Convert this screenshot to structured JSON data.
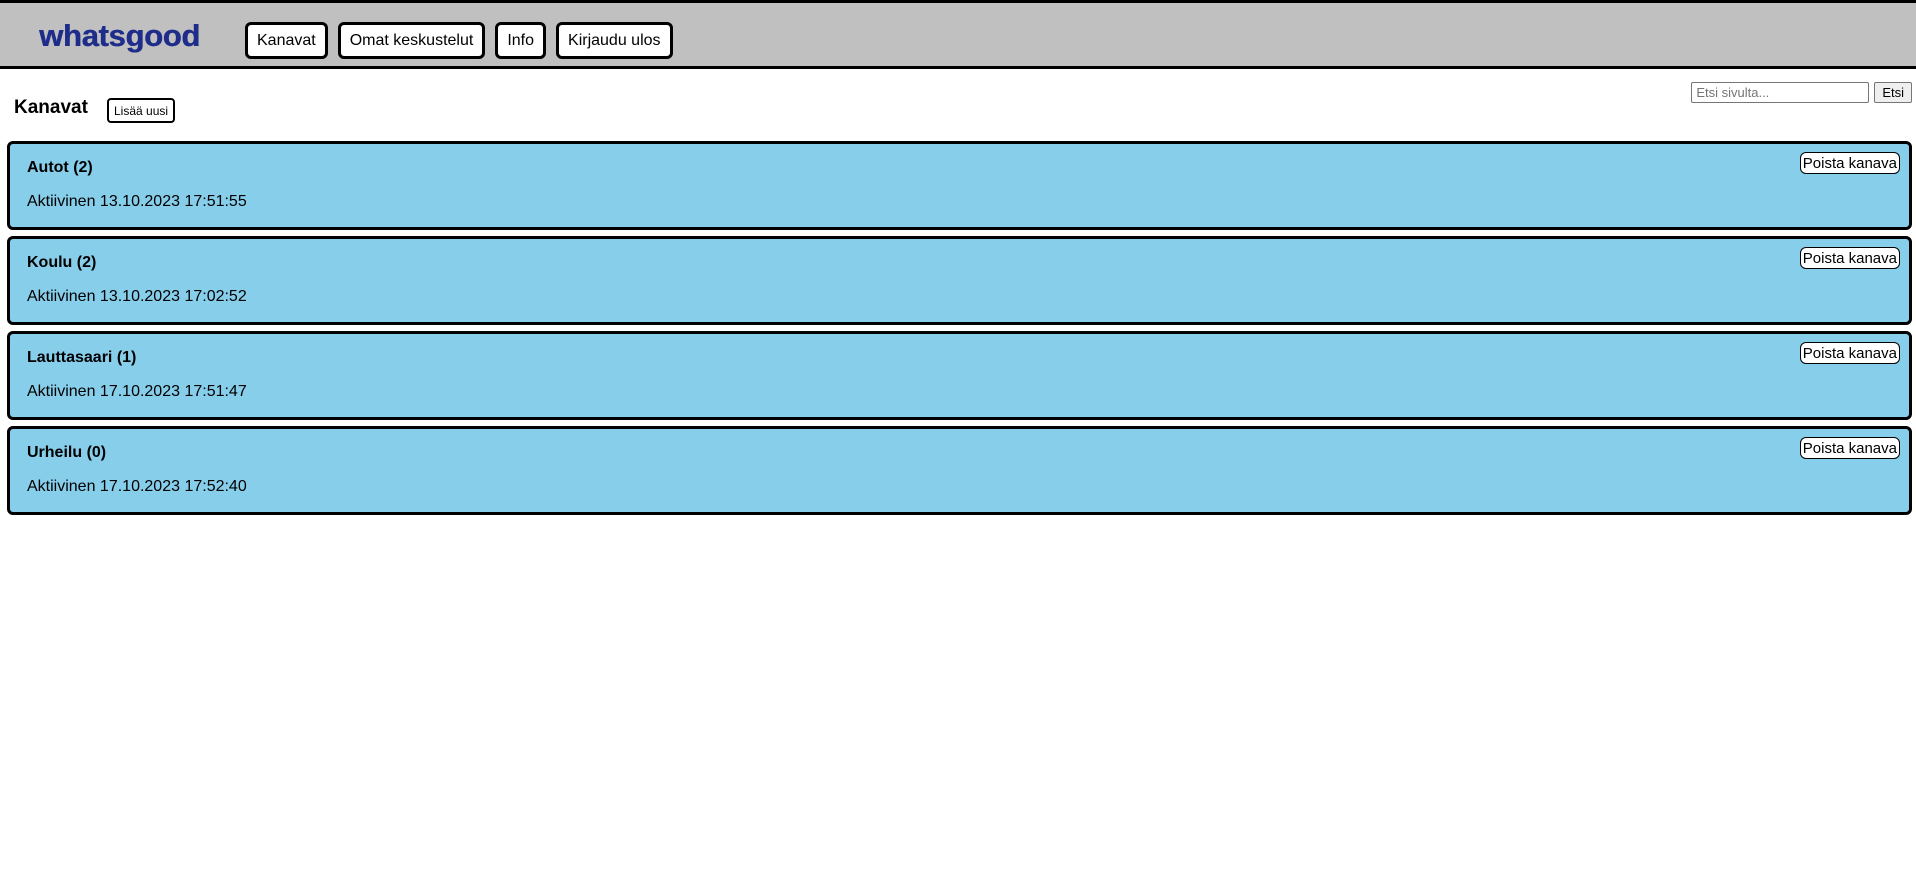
{
  "header": {
    "logo": "whatsgood",
    "nav": [
      {
        "label": "Kanavat"
      },
      {
        "label": "Omat keskustelut"
      },
      {
        "label": "Info"
      },
      {
        "label": "Kirjaudu ulos"
      }
    ]
  },
  "search": {
    "placeholder": "Etsi sivulta...",
    "value": "",
    "button_label": "Etsi"
  },
  "main": {
    "title": "Kanavat",
    "add_label": "Lisää uusi",
    "channels": [
      {
        "name": "Autot (2)",
        "active": "Aktiivinen 13.10.2023 17:51:55",
        "delete_label": "Poista kanava"
      },
      {
        "name": "Koulu (2)",
        "active": "Aktiivinen 13.10.2023 17:02:52",
        "delete_label": "Poista kanava"
      },
      {
        "name": "Lauttasaari (1)",
        "active": "Aktiivinen 17.10.2023 17:51:47",
        "delete_label": "Poista kanava"
      },
      {
        "name": "Urheilu (0)",
        "active": "Aktiivinen 17.10.2023 17:52:40",
        "delete_label": "Poista kanava"
      }
    ]
  },
  "colors": {
    "header_bg": "#c0c0c0",
    "logo": "#1f2d8a",
    "channel_bg": "#87ceeb"
  }
}
